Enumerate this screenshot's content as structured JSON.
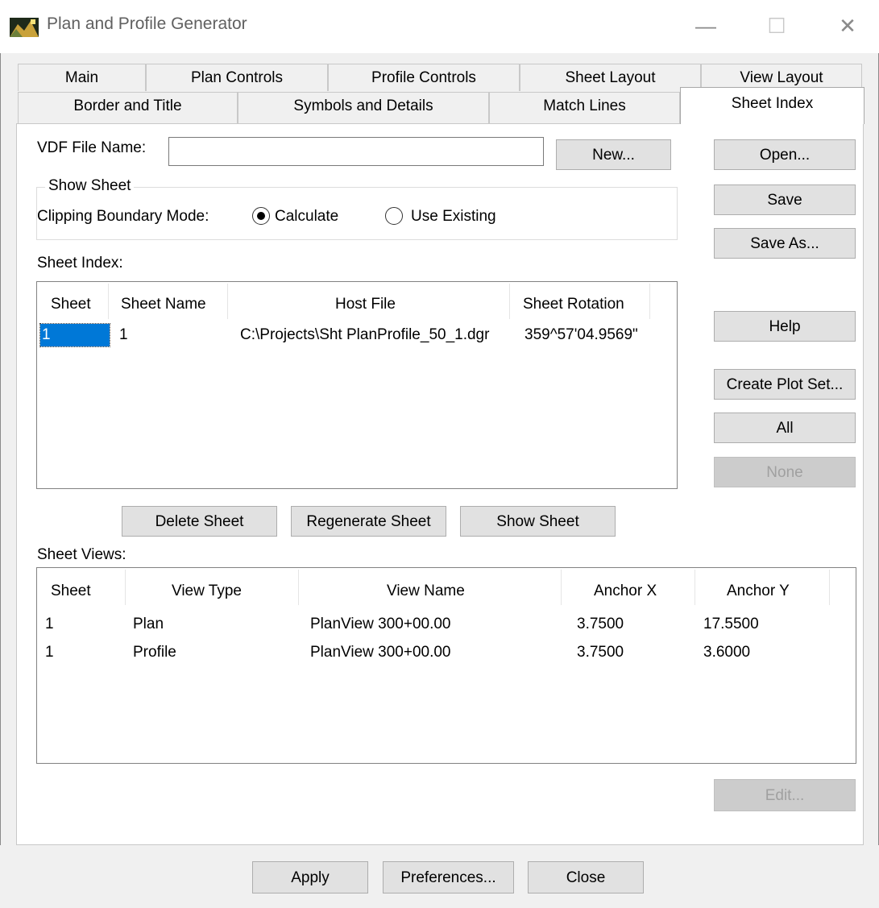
{
  "window": {
    "title": "Plan and Profile Generator",
    "controls": {
      "minimize": "—",
      "maximize": "☐",
      "close": "✕"
    }
  },
  "tabs": {
    "row1": [
      "Main",
      "Plan Controls",
      "Profile Controls",
      "Sheet Layout",
      "View Layout"
    ],
    "row2": [
      "Border and Title",
      "Symbols and Details",
      "Match Lines",
      "Sheet Index"
    ],
    "active": "Sheet Index"
  },
  "vdf": {
    "label": "VDF File Name:",
    "value": "",
    "new_button": "New..."
  },
  "side_buttons": {
    "open": "Open...",
    "save": "Save",
    "save_as": "Save As...",
    "help": "Help",
    "create_plot_set": "Create Plot Set...",
    "all": "All",
    "none": "None",
    "edit": "Edit..."
  },
  "show_sheet": {
    "legend": "Show Sheet",
    "mode_label": "Clipping Boundary Mode:",
    "options": [
      "Calculate",
      "Use Existing"
    ],
    "selected": "Calculate"
  },
  "sheet_index": {
    "label": "Sheet Index:",
    "columns": [
      "Sheet",
      "Sheet Name",
      "Host File",
      "Sheet Rotation"
    ],
    "rows": [
      {
        "sheet": "1",
        "name": "1",
        "host_file": "C:\\Projects\\Sht PlanProfile_50_1.dgr",
        "rotation": "359^57'04.9569\""
      }
    ]
  },
  "sheet_actions": {
    "delete": "Delete Sheet",
    "regenerate": "Regenerate Sheet",
    "show": "Show Sheet"
  },
  "sheet_views": {
    "label": "Sheet Views:",
    "columns": [
      "Sheet",
      "View Type",
      "View Name",
      "Anchor X",
      "Anchor Y"
    ],
    "rows": [
      {
        "sheet": "1",
        "type": "Plan",
        "name": "PlanView 300+00.00",
        "x": "3.7500",
        "y": "17.5500"
      },
      {
        "sheet": "1",
        "type": "Profile",
        "name": "PlanView 300+00.00",
        "x": "3.7500",
        "y": "3.6000"
      }
    ]
  },
  "footer": {
    "apply": "Apply",
    "preferences": "Preferences...",
    "close": "Close"
  },
  "icons": [
    "app-icon",
    "minimize-icon",
    "maximize-icon",
    "close-icon",
    "radio-selected-icon",
    "radio-unselected-icon"
  ]
}
